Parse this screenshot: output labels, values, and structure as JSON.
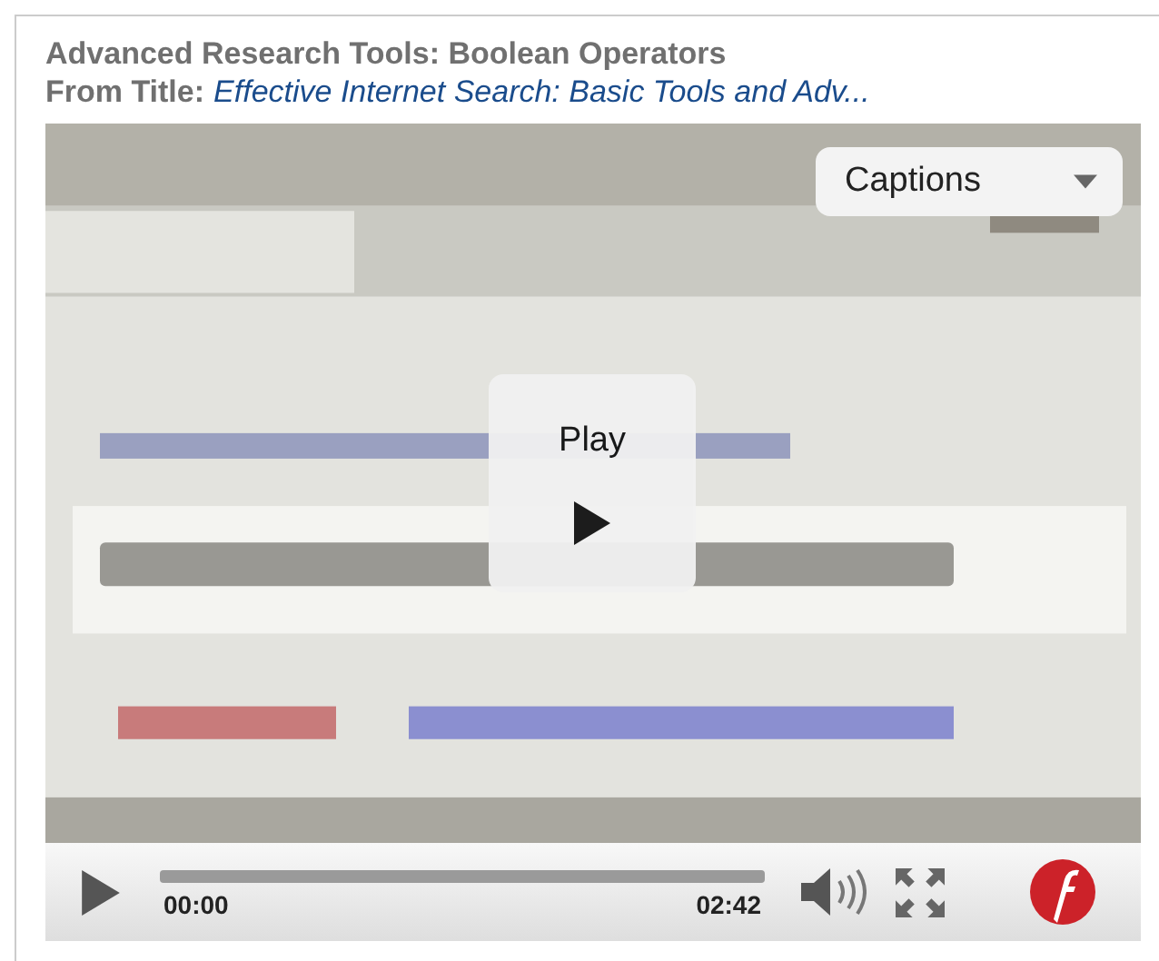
{
  "heading": {
    "title": "Advanced Research Tools: Boolean Operators",
    "from_label": "From Title:",
    "from_title": "Effective Internet Search: Basic Tools and Adv..."
  },
  "player": {
    "captions": "Captions",
    "play_label": "Play",
    "elapsed": "00:00",
    "duration": "02:42",
    "level": 0
  }
}
